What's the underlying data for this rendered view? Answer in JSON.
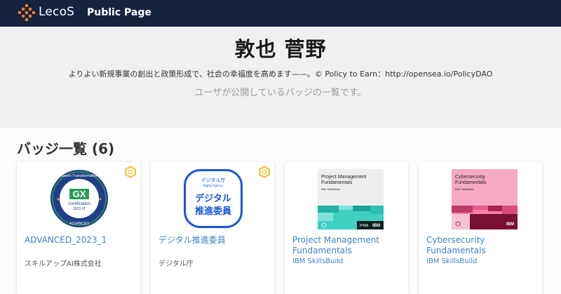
{
  "header": {
    "logo_text": "LecoS",
    "title": "Public Page",
    "brand_color": "#16233f",
    "logo_accent": "#f47b20"
  },
  "profile": {
    "name": "敦也 菅野",
    "bio": "よりよい新規事業の創出と政策形成で、社会の幸福度を高めます——。© Policy to Earn：http://opensea.io/PolicyDAO",
    "description": "ユーザが公開しているバッジの一覧です。"
  },
  "badges": {
    "section_title": "バッジ一覧 (6)",
    "items": [
      {
        "title": "ADVANCED_2023_1",
        "issuer": "スキルアップAI株式会社",
        "verified": true,
        "image": {
          "ring_top": "Green Transformation",
          "ring_bottom": "ADVANCED",
          "center_text": "GX",
          "cert_label": "Certification",
          "year_label": "2023 #1"
        }
      },
      {
        "title": "デジタル推進委員",
        "issuer": "デジタル庁",
        "verified": true,
        "image": {
          "agency_jp": "デジタル庁",
          "agency_en": "Digital Agency",
          "line1": "デジタル",
          "line2": "推進委員"
        }
      },
      {
        "title": "Project Management Fundamentals",
        "issuer": "IBM SkillsBuild",
        "verified": false,
        "image": {
          "heading": "Project Management Fundamentals",
          "sub": "IBM SkillsBuild",
          "footer": "IPMA",
          "brand": "IBM",
          "accent": "#3fd0c2"
        }
      },
      {
        "title": "Cybersecurity Fundamentals",
        "issuer": "IBM SkillsBuild",
        "verified": false,
        "image": {
          "heading": "Cybersecurity Fundamentals",
          "sub": "IBM SkillsBuild",
          "brand": "IBM",
          "accent": "#f47fa8"
        }
      }
    ]
  }
}
